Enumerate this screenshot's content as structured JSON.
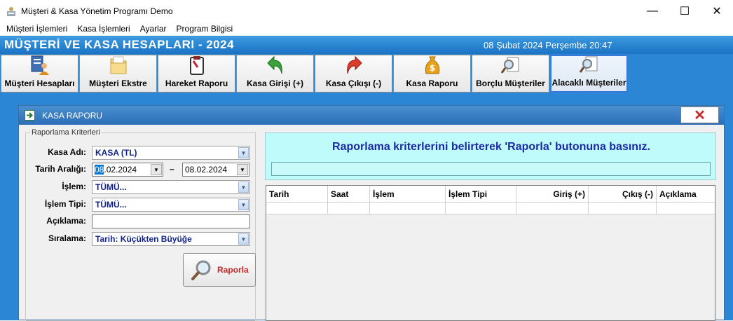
{
  "window": {
    "title": "Müşteri & Kasa Yönetim Programı Demo",
    "minimize_glyph": "—",
    "maximize_glyph": "☐",
    "close_glyph": "✕"
  },
  "menu": [
    "Müşteri İşlemleri",
    "Kasa İşlemleri",
    "Ayarlar",
    "Program Bilgisi"
  ],
  "header": {
    "title": "MÜŞTERİ VE KASA HESAPLARI - 2024",
    "datetime": "08 Şubat 2024 Perşembe 20:47"
  },
  "toolbar": [
    {
      "label": "Müşteri Hesapları",
      "icon": "customer-accounts-icon"
    },
    {
      "label": "Müşteri Ekstre",
      "icon": "folder-icon"
    },
    {
      "label": "Hareket Raporu",
      "icon": "clipboard-icon"
    },
    {
      "label": "Kasa Girişi (+)",
      "icon": "green-arrow-icon"
    },
    {
      "label": "Kasa Çıkışı (-)",
      "icon": "red-arrow-icon"
    },
    {
      "label": "Kasa Raporu",
      "icon": "money-bag-icon"
    },
    {
      "label": "Borçlu Müşteriler",
      "icon": "magnifier-report-icon"
    },
    {
      "label": "Alacaklı Müşteriler",
      "icon": "magnifier-report-icon"
    }
  ],
  "child": {
    "title": "KASA RAPORU",
    "close_glyph": "✕"
  },
  "criteria": {
    "legend": "Raporlama Kriterleri",
    "kasa_label": "Kasa Adı:",
    "kasa_value": "KASA (TL)",
    "tarih_label": "Tarih Aralığı:",
    "date_from_sel": "08",
    "date_from_rest": ".02.2024",
    "date_sep": "–",
    "date_to": "08.02.2024",
    "islem_label": "İşlem:",
    "islem_value": "TÜMÜ...",
    "islem_tipi_label": "İşlem Tipi:",
    "islem_tipi_value": "TÜMÜ...",
    "aciklama_label": "Açıklama:",
    "aciklama_value": "",
    "siralama_label": "Sıralama:",
    "siralama_value": "Tarih: Küçükten Büyüğe",
    "button_label": "Raporla"
  },
  "info": {
    "message": "Raporlama kriterlerini belirterek 'Raporla' butonuna basınız."
  },
  "grid": {
    "columns": [
      "Tarih",
      "Saat",
      "İşlem",
      "İşlem Tipi",
      "Giriş (+)",
      "Çıkış (-)",
      "Açıklama"
    ]
  },
  "colors": {
    "accent": "#2c86d6",
    "info_bg": "#c0fbfb",
    "info_text": "#1a2aa6",
    "combo_text": "#13238c",
    "raporla_text": "#c62828"
  }
}
